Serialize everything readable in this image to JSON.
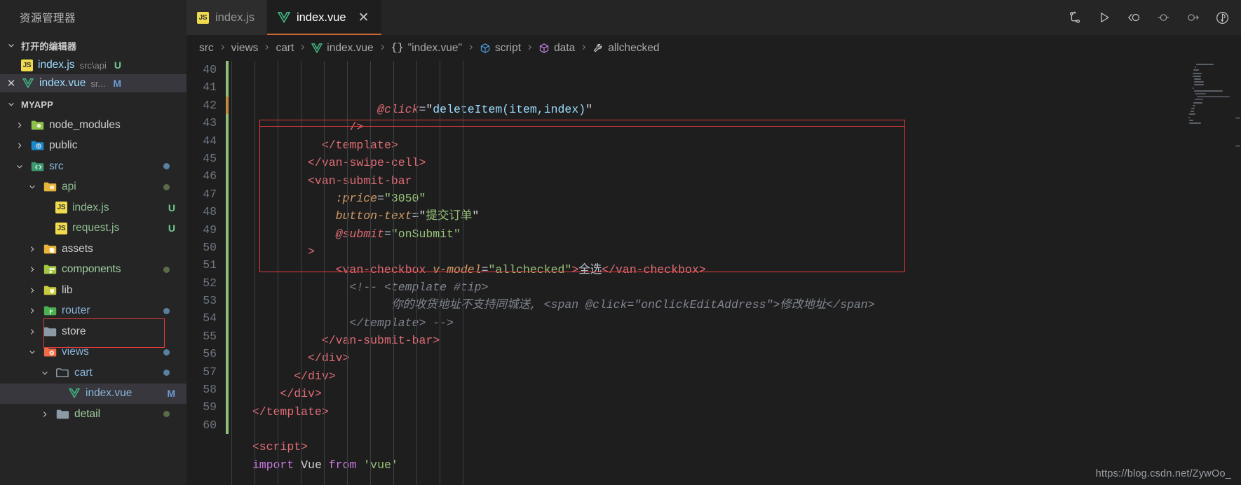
{
  "window": {
    "sidebar_title": "资源管理器",
    "watermark": "https://blog.csdn.net/ZywOo_"
  },
  "tabs": [
    {
      "label": "index.js",
      "icon": "js-file-icon",
      "active": false,
      "closable": false
    },
    {
      "label": "index.vue",
      "icon": "vue-file-icon",
      "active": true,
      "closable": true,
      "close_label": "✕"
    }
  ],
  "editor_actions": [
    {
      "name": "split-compare-icon",
      "title": "Compare"
    },
    {
      "name": "run-play-icon",
      "title": "Run"
    },
    {
      "name": "debug-step-back-icon",
      "title": "Step Back"
    },
    {
      "name": "debug-breakpoint-icon",
      "title": "Breakpoint"
    },
    {
      "name": "debug-step-over-icon",
      "title": "Step Over"
    },
    {
      "name": "debug-alt-icon",
      "title": "Run and Debug"
    }
  ],
  "breadcrumb": [
    {
      "label": "src",
      "icon": ""
    },
    {
      "label": "views",
      "icon": ""
    },
    {
      "label": "cart",
      "icon": ""
    },
    {
      "label": "index.vue",
      "icon": "vue-file-icon"
    },
    {
      "label": "\"index.vue\"",
      "icon": "braces-icon"
    },
    {
      "label": "script",
      "icon": "cube-blue-icon"
    },
    {
      "label": "data",
      "icon": "cube-purple-icon"
    },
    {
      "label": "allchecked",
      "icon": "wrench-icon"
    }
  ],
  "sidebar": {
    "open_editors": {
      "title": "打开的编辑器",
      "items": [
        {
          "name": "index.js",
          "desc": "src\\api",
          "badge": "U",
          "badge_kind": "untracked",
          "icon": "js-file-icon",
          "selected": false,
          "closable": false
        },
        {
          "name": "index.vue",
          "desc": "sr...",
          "badge": "M",
          "badge_kind": "modified",
          "icon": "vue-file-icon",
          "selected": true,
          "closable": true,
          "close_label": "✕"
        }
      ]
    },
    "project": {
      "title": "MYAPP",
      "tree": [
        {
          "label": "node_modules",
          "indent": 1,
          "expanded": false,
          "icon": "folder-node-icon",
          "dot": "",
          "tag": "",
          "selected": false
        },
        {
          "label": "public",
          "indent": 1,
          "expanded": false,
          "icon": "folder-public-icon",
          "dot": "",
          "tag": "",
          "selected": false
        },
        {
          "label": "src",
          "indent": 1,
          "expanded": true,
          "icon": "folder-src-icon",
          "dot": "#5a7fa0",
          "tag": "",
          "selected": false,
          "label_color": "#8ab4d8"
        },
        {
          "label": "api",
          "indent": 2,
          "expanded": true,
          "icon": "folder-api-icon",
          "dot": "#5a6b4a",
          "tag": "",
          "selected": false,
          "label_color": "#8fbc8f"
        },
        {
          "label": "index.js",
          "indent": 3,
          "expanded": null,
          "icon": "js-file-icon",
          "dot": "",
          "tag": "U",
          "tag_color": "#73c991",
          "selected": false,
          "label_color": "#8fbc8f"
        },
        {
          "label": "request.js",
          "indent": 3,
          "expanded": null,
          "icon": "js-file-icon",
          "dot": "",
          "tag": "U",
          "tag_color": "#73c991",
          "selected": false,
          "label_color": "#8fbc8f"
        },
        {
          "label": "assets",
          "indent": 2,
          "expanded": false,
          "icon": "folder-assets-icon",
          "dot": "",
          "tag": "",
          "selected": false
        },
        {
          "label": "components",
          "indent": 2,
          "expanded": false,
          "icon": "folder-components-icon",
          "dot": "#5a6b4a",
          "tag": "",
          "selected": false,
          "label_color": "#9fcf9f"
        },
        {
          "label": "lib",
          "indent": 2,
          "expanded": false,
          "icon": "folder-lib-icon",
          "dot": "",
          "tag": "",
          "selected": false
        },
        {
          "label": "router",
          "indent": 2,
          "expanded": false,
          "icon": "folder-router-icon",
          "dot": "#5a7fa0",
          "tag": "",
          "selected": false,
          "label_color": "#8ab4d8"
        },
        {
          "label": "store",
          "indent": 2,
          "expanded": false,
          "icon": "folder-store-icon",
          "dot": "",
          "tag": "",
          "selected": false
        },
        {
          "label": "views",
          "indent": 2,
          "expanded": true,
          "icon": "folder-views-icon",
          "dot": "#5a7fa0",
          "tag": "",
          "selected": false,
          "label_color": "#8ab4d8"
        },
        {
          "label": "cart",
          "indent": 3,
          "expanded": true,
          "icon": "folder-open-icon",
          "dot": "#5a7fa0",
          "tag": "",
          "selected": false,
          "label_color": "#8ab4d8"
        },
        {
          "label": "index.vue",
          "indent": 4,
          "expanded": null,
          "icon": "vue-file-icon",
          "dot": "",
          "tag": "M",
          "tag_color": "#6f9ad3",
          "selected": true,
          "label_color": "#8ab4d8",
          "highlighted": true
        },
        {
          "label": "detail",
          "indent": 3,
          "expanded": false,
          "icon": "folder-detail-icon",
          "dot": "#5a6b4a",
          "tag": "",
          "selected": false,
          "label_color": "#9fcf9f"
        }
      ]
    }
  },
  "code": {
    "first_line": 40,
    "lines": [
      {
        "n": 40,
        "indent": 10,
        "change": "green",
        "tokens": [
          {
            "t": "@click",
            "c": "tok-at"
          },
          {
            "t": "=",
            "c": "tok-punct"
          },
          {
            "t": "\"",
            "c": "tok-strw"
          },
          {
            "t": "deleteItem(item,index)",
            "c": "tok-str-blue"
          },
          {
            "t": "\"",
            "c": "tok-strw"
          }
        ]
      },
      {
        "n": 41,
        "indent": 8,
        "change": "green",
        "tokens": [
          {
            "t": "/>",
            "c": "tok-tag"
          }
        ]
      },
      {
        "n": 42,
        "indent": 6,
        "change": "orange",
        "tokens": [
          {
            "t": "</template>",
            "c": "tok-tag"
          }
        ]
      },
      {
        "n": 43,
        "indent": 5,
        "change": "green",
        "tokens": [
          {
            "t": "</van-swipe-cell>",
            "c": "tok-tag"
          }
        ]
      },
      {
        "n": 44,
        "indent": 5,
        "change": "green",
        "tokens": [
          {
            "t": "<van-submit-bar",
            "c": "tok-tag"
          }
        ]
      },
      {
        "n": 45,
        "indent": 7,
        "change": "green",
        "tokens": [
          {
            "t": ":price",
            "c": "tok-attr"
          },
          {
            "t": "=",
            "c": "tok-punct"
          },
          {
            "t": "\"3050\"",
            "c": "tok-attrval"
          }
        ]
      },
      {
        "n": 46,
        "indent": 7,
        "change": "green",
        "tokens": [
          {
            "t": "button-text",
            "c": "tok-attr"
          },
          {
            "t": "=",
            "c": "tok-punct"
          },
          {
            "t": "\"",
            "c": "tok-strw"
          },
          {
            "t": "提交订单",
            "c": "tok-str"
          },
          {
            "t": "\"",
            "c": "tok-strw"
          }
        ]
      },
      {
        "n": 47,
        "indent": 7,
        "change": "green",
        "tokens": [
          {
            "t": "@submit",
            "c": "tok-at"
          },
          {
            "t": "=",
            "c": "tok-punct"
          },
          {
            "t": "\"onSubmit\"",
            "c": "tok-attrval"
          }
        ]
      },
      {
        "n": 48,
        "indent": 5,
        "change": "green",
        "tokens": [
          {
            "t": ">",
            "c": "tok-tag"
          }
        ]
      },
      {
        "n": 49,
        "indent": 7,
        "change": "green",
        "tokens": [
          {
            "t": "<van-checkbox",
            "c": "tok-tag"
          },
          {
            "t": " ",
            "c": "tok-plain"
          },
          {
            "t": "v-model",
            "c": "tok-attr"
          },
          {
            "t": "=",
            "c": "tok-punct"
          },
          {
            "t": "\"allchecked\"",
            "c": "tok-attrval"
          },
          {
            "t": ">",
            "c": "tok-tag"
          },
          {
            "t": "全选",
            "c": "tok-cn"
          },
          {
            "t": "</van-checkbox>",
            "c": "tok-tag"
          }
        ]
      },
      {
        "n": 50,
        "indent": 8,
        "change": "green",
        "tokens": [
          {
            "t": "<!-- <template #tip>",
            "c": "tok-cmt"
          }
        ]
      },
      {
        "n": 51,
        "indent": 11,
        "change": "green",
        "tokens": [
          {
            "t": "你的收货地址不支持同城送, <span @click=\"onClickEditAddress\">修改地址</span>",
            "c": "tok-cmt"
          }
        ]
      },
      {
        "n": 52,
        "indent": 8,
        "change": "green",
        "tokens": [
          {
            "t": "</template> -->",
            "c": "tok-cmt"
          }
        ]
      },
      {
        "n": 53,
        "indent": 6,
        "change": "green",
        "tokens": [
          {
            "t": "</van-submit-bar>",
            "c": "tok-tag"
          }
        ]
      },
      {
        "n": 54,
        "indent": 5,
        "change": "green",
        "tokens": [
          {
            "t": "</div>",
            "c": "tok-tag"
          }
        ]
      },
      {
        "n": 55,
        "indent": 4,
        "change": "green",
        "tokens": [
          {
            "t": "</div>",
            "c": "tok-tag"
          }
        ]
      },
      {
        "n": 56,
        "indent": 3,
        "change": "green",
        "tokens": [
          {
            "t": "</div>",
            "c": "tok-tag"
          }
        ]
      },
      {
        "n": 57,
        "indent": 1,
        "change": "green",
        "tokens": [
          {
            "t": "</template>",
            "c": "tok-tag"
          }
        ]
      },
      {
        "n": 58,
        "indent": 0,
        "change": "green",
        "tokens": [
          {
            "t": "",
            "c": "tok-plain"
          }
        ]
      },
      {
        "n": 59,
        "indent": 1,
        "change": "green",
        "tokens": [
          {
            "t": "<script>",
            "c": "tok-tag"
          }
        ]
      },
      {
        "n": 60,
        "indent": 1,
        "change": "green",
        "tokens": [
          {
            "t": "import",
            "c": "tok-kw"
          },
          {
            "t": " Vue ",
            "c": "tok-plain"
          },
          {
            "t": "from",
            "c": "tok-kw"
          },
          {
            "t": " ",
            "c": "tok-plain"
          },
          {
            "t": "'vue'",
            "c": "tok-str"
          }
        ]
      }
    ]
  },
  "colors": {
    "accent_tab": "#cc6633",
    "highlight_box": "#e03b3b",
    "editor_bg": "#1e1e1e",
    "sidebar_bg": "#252526",
    "tab_inactive_bg": "#2d2d2d"
  }
}
